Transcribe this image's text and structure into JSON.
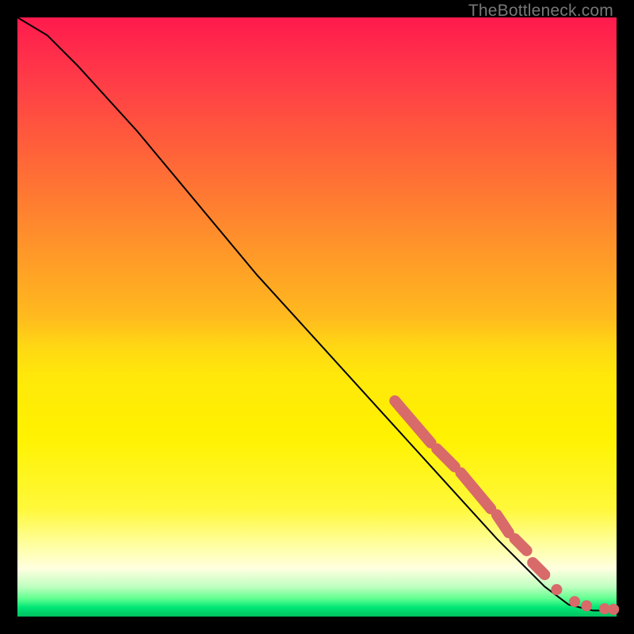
{
  "watermark": "TheBottleneck.com",
  "chart_data": {
    "type": "line",
    "title": "",
    "xlabel": "",
    "ylabel": "",
    "xlim": [
      0,
      100
    ],
    "ylim": [
      0,
      100
    ],
    "curve": [
      {
        "x": 0,
        "y": 100
      },
      {
        "x": 5,
        "y": 97
      },
      {
        "x": 10,
        "y": 92
      },
      {
        "x": 20,
        "y": 81
      },
      {
        "x": 30,
        "y": 69
      },
      {
        "x": 40,
        "y": 57
      },
      {
        "x": 50,
        "y": 46
      },
      {
        "x": 60,
        "y": 35
      },
      {
        "x": 70,
        "y": 24
      },
      {
        "x": 80,
        "y": 13
      },
      {
        "x": 88,
        "y": 5
      },
      {
        "x": 92,
        "y": 2
      },
      {
        "x": 96,
        "y": 1
      },
      {
        "x": 100,
        "y": 1
      }
    ],
    "highlighted_segments": [
      {
        "x1": 63,
        "y1": 36,
        "x2": 69,
        "y2": 29
      },
      {
        "x1": 70,
        "y1": 28,
        "x2": 73,
        "y2": 25
      },
      {
        "x1": 74,
        "y1": 24,
        "x2": 79,
        "y2": 18
      },
      {
        "x1": 80,
        "y1": 17,
        "x2": 82,
        "y2": 14
      },
      {
        "x1": 83,
        "y1": 13,
        "x2": 85,
        "y2": 11
      },
      {
        "x1": 86,
        "y1": 9,
        "x2": 88,
        "y2": 7
      }
    ],
    "highlighted_points": [
      {
        "x": 90,
        "y": 4.5
      },
      {
        "x": 93,
        "y": 2.5
      },
      {
        "x": 95,
        "y": 1.8
      },
      {
        "x": 98,
        "y": 1.3
      },
      {
        "x": 99.5,
        "y": 1.2
      }
    ]
  }
}
